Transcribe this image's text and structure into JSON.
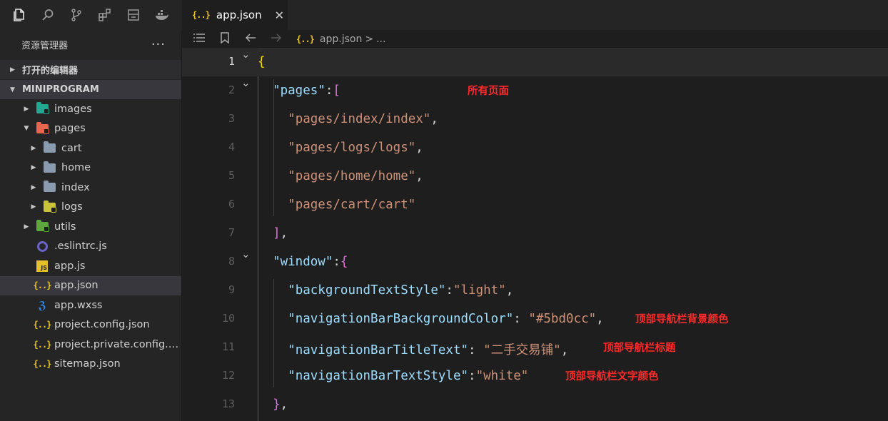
{
  "activity": {
    "icons": [
      "explorer-icon",
      "search-icon",
      "source-control-icon",
      "extensions-icon",
      "remote-icon",
      "docker-icon"
    ]
  },
  "sidebar": {
    "title": "资源管理器",
    "more": "···",
    "sections": {
      "open_editors": "打开的编辑器",
      "project": "MINIPROGRAM"
    },
    "tree": [
      {
        "label": "images",
        "indent": 1,
        "arrow": "▶",
        "icon": "folder-images-icon"
      },
      {
        "label": "pages",
        "indent": 1,
        "arrow": "▼",
        "icon": "folder-pages-icon"
      },
      {
        "label": "cart",
        "indent": 2,
        "arrow": "▶",
        "icon": "folder-icon"
      },
      {
        "label": "home",
        "indent": 2,
        "arrow": "▶",
        "icon": "folder-icon"
      },
      {
        "label": "index",
        "indent": 2,
        "arrow": "▶",
        "icon": "folder-icon"
      },
      {
        "label": "logs",
        "indent": 2,
        "arrow": "▶",
        "icon": "folder-logs-icon"
      },
      {
        "label": "utils",
        "indent": 1,
        "arrow": "▶",
        "icon": "folder-utils-icon"
      },
      {
        "label": ".eslintrc.js",
        "indent": 1,
        "arrow": "",
        "icon": "eslint-icon"
      },
      {
        "label": "app.js",
        "indent": 1,
        "arrow": "",
        "icon": "js-file-icon"
      },
      {
        "label": "app.json",
        "indent": 1,
        "arrow": "",
        "icon": "json-file-icon",
        "selected": true
      },
      {
        "label": "app.wxss",
        "indent": 1,
        "arrow": "",
        "icon": "css-file-icon"
      },
      {
        "label": "project.config.json",
        "indent": 1,
        "arrow": "",
        "icon": "json-file-icon"
      },
      {
        "label": "project.private.config.js...",
        "indent": 1,
        "arrow": "",
        "icon": "json-file-icon"
      },
      {
        "label": "sitemap.json",
        "indent": 1,
        "arrow": "",
        "icon": "json-file-icon"
      }
    ]
  },
  "tab": {
    "icon_text": "{..}",
    "label": "app.json",
    "close": "✕"
  },
  "breadcrumb": {
    "icon_text": "{..}",
    "file": "app.json",
    "sep": ">",
    "rest": "..."
  },
  "editor": {
    "lines": [
      {
        "n": "1",
        "fold": "⌄",
        "current": true,
        "html": "<span class='b1'>{</span>"
      },
      {
        "n": "2",
        "fold": "⌄",
        "html": "  <span class='k'>\"pages\"</span><span class='p'>:</span><span class='b2'>[</span>"
      },
      {
        "n": "3",
        "html": "    <span class='s'>\"pages/index/index\"</span><span class='p'>,</span>"
      },
      {
        "n": "4",
        "html": "    <span class='s'>\"pages/logs/logs\"</span><span class='p'>,</span>"
      },
      {
        "n": "5",
        "html": "    <span class='s'>\"pages/home/home\"</span><span class='p'>,</span>"
      },
      {
        "n": "6",
        "html": "    <span class='s'>\"pages/cart/cart\"</span>"
      },
      {
        "n": "7",
        "html": "  <span class='b2'>]</span><span class='p'>,</span>"
      },
      {
        "n": "8",
        "fold": "⌄",
        "html": "  <span class='k'>\"window\"</span><span class='p'>:</span><span class='b2'>{</span>"
      },
      {
        "n": "9",
        "html": "    <span class='k'>\"backgroundTextStyle\"</span><span class='p'>:</span><span class='s'>\"light\"</span><span class='p'>,</span>"
      },
      {
        "n": "10",
        "html": "    <span class='k'>\"navigationBarBackgroundColor\"</span><span class='p'>: </span><span class='s'>\"#5bd0cc\"</span><span class='p'>,</span>"
      },
      {
        "n": "11",
        "html": "    <span class='k'>\"navigationBarTitleText\"</span><span class='p'>: </span><span class='s'>\"二手交易铺\"</span><span class='p'>,</span>"
      },
      {
        "n": "12",
        "html": "    <span class='k'>\"navigationBarTextStyle\"</span><span class='p'>:</span><span class='s'>\"white\"</span>"
      },
      {
        "n": "13",
        "html": "  <span class='b2'>}</span><span class='p'>,</span>"
      }
    ],
    "notes": {
      "pages": "所有页面",
      "bg_color": "顶部导航栏背景颜色",
      "title_text": "顶部导航栏标题",
      "text_style": "顶部导航栏文字颜色"
    }
  },
  "colors": {
    "key": "#9cdcfe",
    "string": "#ce9178",
    "bracket_gold": "#ffd700",
    "bracket_violet": "#da70d6",
    "annotation": "#ff2a2a"
  }
}
